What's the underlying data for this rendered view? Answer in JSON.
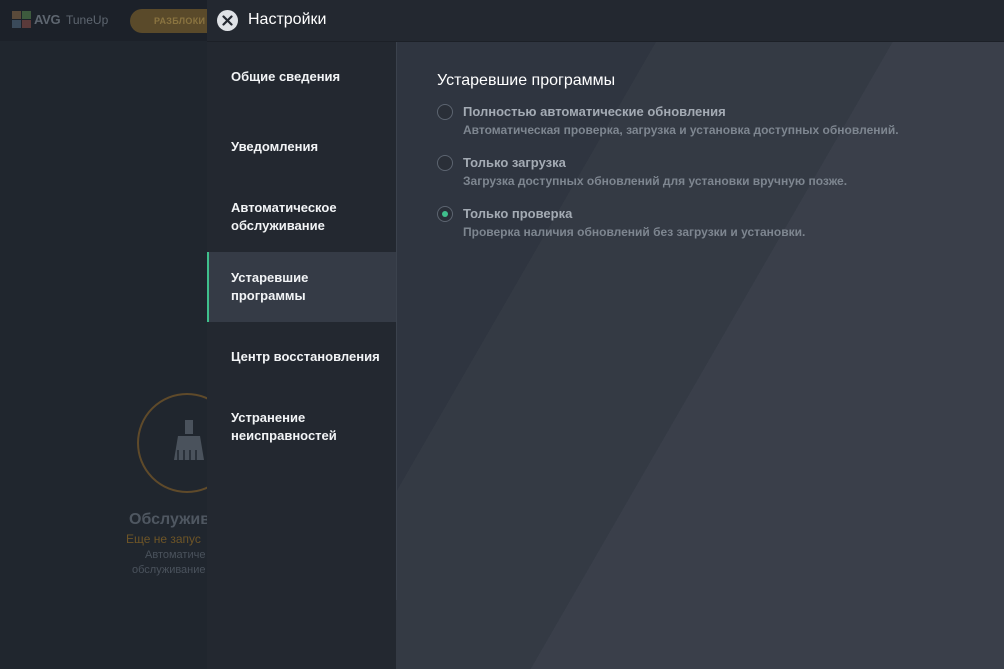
{
  "background_app": {
    "brand": "AVG",
    "product": "TuneUp",
    "unlock_button_label": "РАЗБЛОКИ",
    "maintenance_title": "Обслужив",
    "maintenance_status": "Еще не запус",
    "maintenance_desc_line1": "Автоматиче",
    "maintenance_desc_line2": "обслуживание"
  },
  "settings": {
    "title": "Настройки",
    "nav": [
      {
        "label": "Общие сведения",
        "active": false
      },
      {
        "label": "Уведомления",
        "active": false
      },
      {
        "label": "Автоматическое обслуживание",
        "active": false
      },
      {
        "label": "Устаревшие программы",
        "active": true
      },
      {
        "label": "Центр восстановления",
        "active": false
      },
      {
        "label": "Устранение неисправностей",
        "active": false
      }
    ],
    "section_title": "Устаревшие программы",
    "options": [
      {
        "label": "Полностью автоматические обновления",
        "description": "Автоматическая проверка, загрузка и установка доступных обновлений.",
        "selected": false
      },
      {
        "label": "Только загрузка",
        "description": "Загрузка доступных обновлений для установки вручную позже.",
        "selected": false
      },
      {
        "label": "Только проверка",
        "description": "Проверка наличия обновлений без загрузки и установки.",
        "selected": true
      }
    ]
  },
  "colors": {
    "accent": "#3fbf8c",
    "panel_bg": "#2f3540",
    "sidebar_bg": "#232830"
  },
  "icons": {
    "close": "close-icon",
    "brush": "brush-icon",
    "logo": "avg-logo-icon"
  }
}
